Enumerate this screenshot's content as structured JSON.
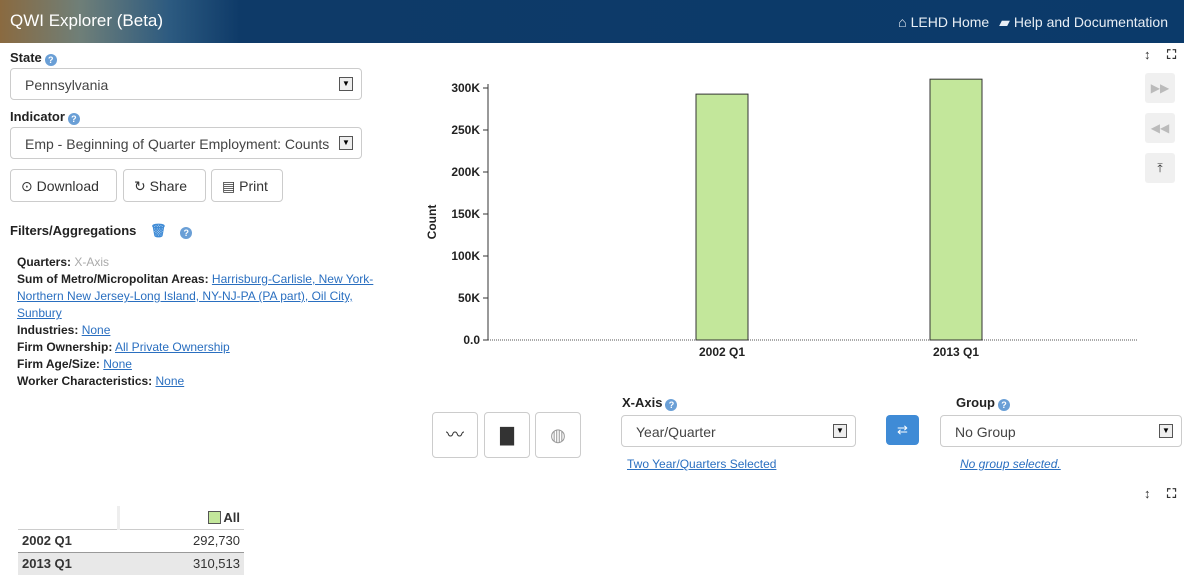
{
  "app": {
    "title": "QWI Explorer (Beta)",
    "home_link": "LEHD Home",
    "help_link": "Help and Documentation"
  },
  "state": {
    "label": "State",
    "value": "Pennsylvania"
  },
  "indicator": {
    "label": "Indicator",
    "value": "Emp - Beginning of Quarter Employment: Counts"
  },
  "actions": {
    "download": "Download",
    "share": "Share",
    "print": "Print"
  },
  "filters": {
    "title": "Filters/Aggregations",
    "quarters_label": "Quarters:",
    "quarters_value": "X-Axis",
    "metro_label": "Sum of Metro/Micropolitan Areas:",
    "metro_value": "Harrisburg-Carlisle, New York-Northern New Jersey-Long Island, NY-NJ-PA (PA part), Oil City, Sunbury",
    "industries_label": "Industries:",
    "industries_value": "None",
    "ownership_label": "Firm Ownership:",
    "ownership_value": "All Private Ownership",
    "age_label": "Firm Age/Size:",
    "age_value": "None",
    "worker_label": "Worker Characteristics:",
    "worker_value": "None"
  },
  "chart_data": {
    "type": "bar",
    "categories": [
      "2002 Q1",
      "2013 Q1"
    ],
    "series": [
      {
        "name": "All",
        "values": [
          292730,
          310513
        ],
        "color": "#c3e79b"
      }
    ],
    "ylabel": "Count",
    "ylim": [
      0,
      300000
    ],
    "yticks": [
      "0.0",
      "50K",
      "100K",
      "150K",
      "200K",
      "250K",
      "300K"
    ],
    "grid": false
  },
  "xaxis": {
    "label": "X-Axis",
    "value": "Year/Quarter",
    "note": "Two Year/Quarters Selected"
  },
  "group": {
    "label": "Group",
    "value": "No Group",
    "note": "No group selected."
  },
  "table": {
    "header": "All",
    "rows": [
      {
        "label": "2002 Q1",
        "value": "292,730"
      },
      {
        "label": "2013 Q1",
        "value": "310,513"
      }
    ]
  }
}
